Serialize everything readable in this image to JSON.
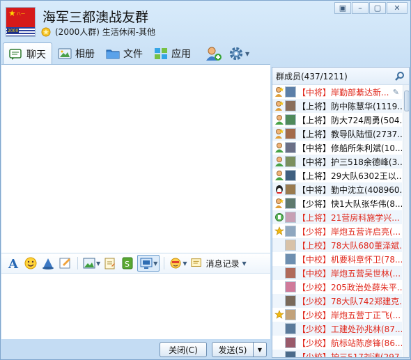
{
  "window": {
    "group_name": "海军三都澳战友群",
    "group_info": "(2000人群) 生活休闲-其他",
    "logo_text_top": "八一",
    "logo_text_bottom": "2000",
    "controls": [
      "▣",
      "–",
      "▢",
      "✕"
    ]
  },
  "toolbar": {
    "tabs": [
      {
        "label": "聊天",
        "icon": "chat-icon",
        "active": true
      },
      {
        "label": "相册",
        "icon": "album-icon",
        "active": false
      },
      {
        "label": "文件",
        "icon": "folder-icon",
        "active": false
      },
      {
        "label": "应用",
        "icon": "apps-icon",
        "active": false
      }
    ],
    "add_member_icon": "add-member-icon",
    "settings_icon": "gear-icon"
  },
  "input_toolbar": {
    "items": [
      "font-icon",
      "emoticon-icon",
      "magic-icon",
      "scribble-icon",
      "image-icon",
      "clipboard-icon",
      "document-icon",
      "screenshot-icon",
      "shake-icon",
      "history-icon"
    ],
    "history_label": "消息记录"
  },
  "buttons": {
    "close_label": "关闭(C)",
    "send_label": "发送(S)",
    "send_menu": "▼"
  },
  "members": {
    "header": "群成员(437/1211)",
    "rows": [
      {
        "text": "【中将】岸勤部綦达新...",
        "red": true,
        "status": "admin"
      },
      {
        "text": "【上将】防中陈慧华(1119...",
        "red": false,
        "status": "admin"
      },
      {
        "text": "【上将】防大724周勇(504...",
        "red": false,
        "status": "online"
      },
      {
        "text": "【上将】教导队陆恒(2737...",
        "red": false,
        "status": "admin"
      },
      {
        "text": "【中将】修船所朱利斌(10...",
        "red": false,
        "status": "online"
      },
      {
        "text": "【中将】护三518余德峰(3...",
        "red": false,
        "status": "online"
      },
      {
        "text": "【上将】29大队6302王以...",
        "red": false,
        "status": "online"
      },
      {
        "text": "【中将】勤中沈立(408960...",
        "red": false,
        "status": "qq"
      },
      {
        "text": "【少将】快1大队张华伟(8...",
        "red": false,
        "status": "admin"
      },
      {
        "text": "【上将】21营房科施学兴...",
        "red": true,
        "status": "mobile"
      },
      {
        "text": "【少将】岸炮五营许启亮(...",
        "red": true,
        "status": "star"
      },
      {
        "text": "【上校】78大队680董泽斌...",
        "red": true,
        "status": "none"
      },
      {
        "text": "【中校】机要科章怀卫(78...",
        "red": true,
        "status": "none"
      },
      {
        "text": "【中校】岸炮五营吴世林(...",
        "red": true,
        "status": "none"
      },
      {
        "text": "【少校】205政治处薛朱平...",
        "red": true,
        "status": "none"
      },
      {
        "text": "【少校】78大队742郑建克...",
        "red": true,
        "status": "none"
      },
      {
        "text": "【少校】岸炮五营丁正飞(...",
        "red": true,
        "status": "star"
      },
      {
        "text": "【少校】工建处孙兆林(87...",
        "red": true,
        "status": "none"
      },
      {
        "text": "【少校】航标站陈彦锋(86...",
        "red": true,
        "status": "none"
      },
      {
        "text": "【少校】护三517刘涛(297...",
        "red": true,
        "status": "none"
      }
    ]
  },
  "colors": {
    "red_name": "#e0281c",
    "frame": "#c4dcf3",
    "accent": "#2f6db3"
  }
}
